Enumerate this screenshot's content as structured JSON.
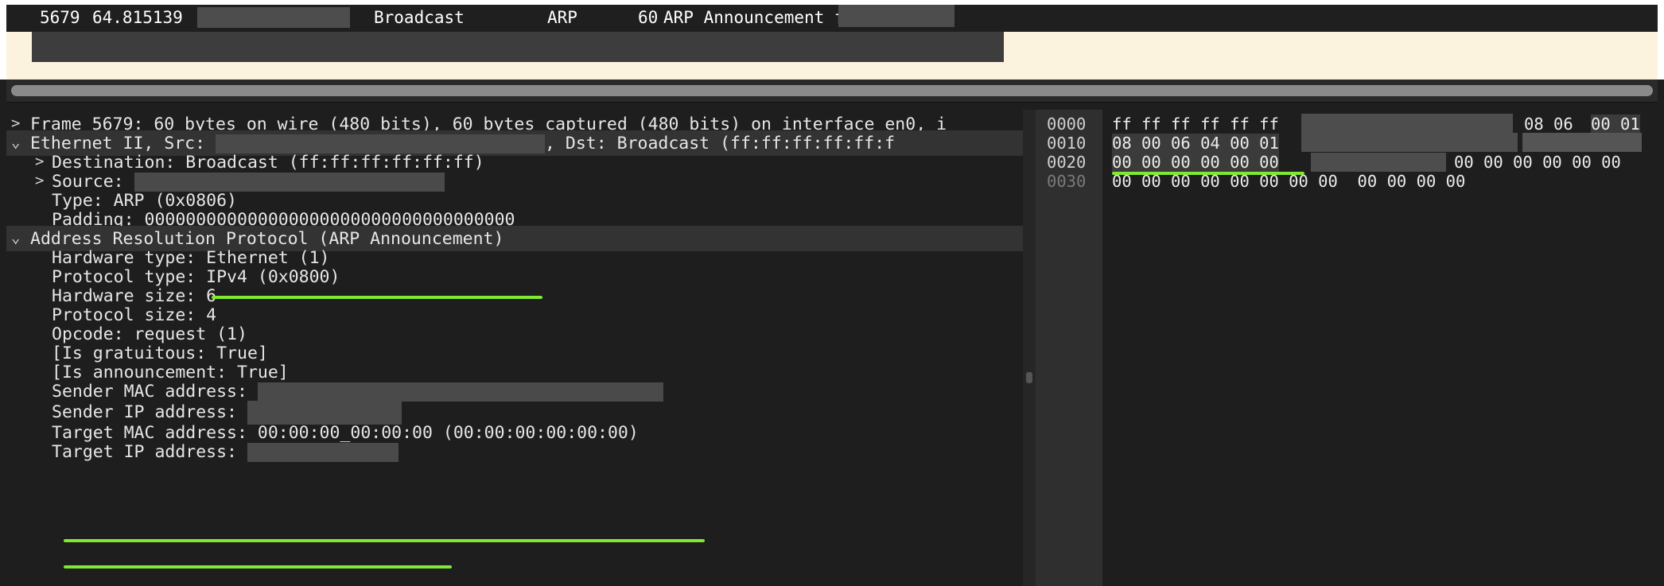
{
  "packet_list": {
    "selected": {
      "number": "5679",
      "time": "64.815139",
      "destination": "Broadcast",
      "protocol": "ARP",
      "length": "60",
      "info": "ARP Announcement for"
    }
  },
  "details": {
    "frame": "Frame 5679: 60 bytes on wire (480 bits), 60 bytes captured (480 bits) on interface en0, i",
    "ethernet_prefix": "Ethernet II, Src:",
    "ethernet_dst": ", Dst: Broadcast (ff:ff:ff:ff:ff:f",
    "destination": "Destination: Broadcast (ff:ff:ff:ff:ff:ff)",
    "source": "Source:",
    "type": "Type: ARP (0x0806)",
    "padding": "Padding: 000000000000000000000000000000000000",
    "arp": "Address Resolution Protocol (ARP Announcement)",
    "hw_type": "Hardware type: Ethernet (1)",
    "proto_type": "Protocol type: IPv4 (0x0800)",
    "hw_size": "Hardware size: 6",
    "proto_size": "Protocol size: 4",
    "opcode": "Opcode: request (1)",
    "gratuitous": "[Is gratuitous: True]",
    "announcement": "[Is announcement: True]",
    "sender_mac": "Sender MAC address:",
    "sender_ip": "Sender IP address:",
    "target_mac": "Target MAC address: 00:00:00_00:00:00 (00:00:00:00:00:00)",
    "target_ip": "Target IP address:"
  },
  "bytes": {
    "offsets": [
      "0000",
      "0010",
      "0020",
      "0030"
    ],
    "row0_a": "ff ff ff ff ff ff",
    "row0_b": "08 06",
    "row0_c": "00 01",
    "row1_a": "08 00 06 04 00 01",
    "row2_a": "00 00 00 00 00 00",
    "row2_b": "00 00 00 00 00 00",
    "row3_a": "00 00 00 00 00 00 00 00  00 00 00 00"
  },
  "colors": {
    "highlight": "#7fe82f",
    "redaction": "#4a4a4a",
    "row_bg": "#1f1f1f",
    "row2_bg": "#fcf3de"
  }
}
